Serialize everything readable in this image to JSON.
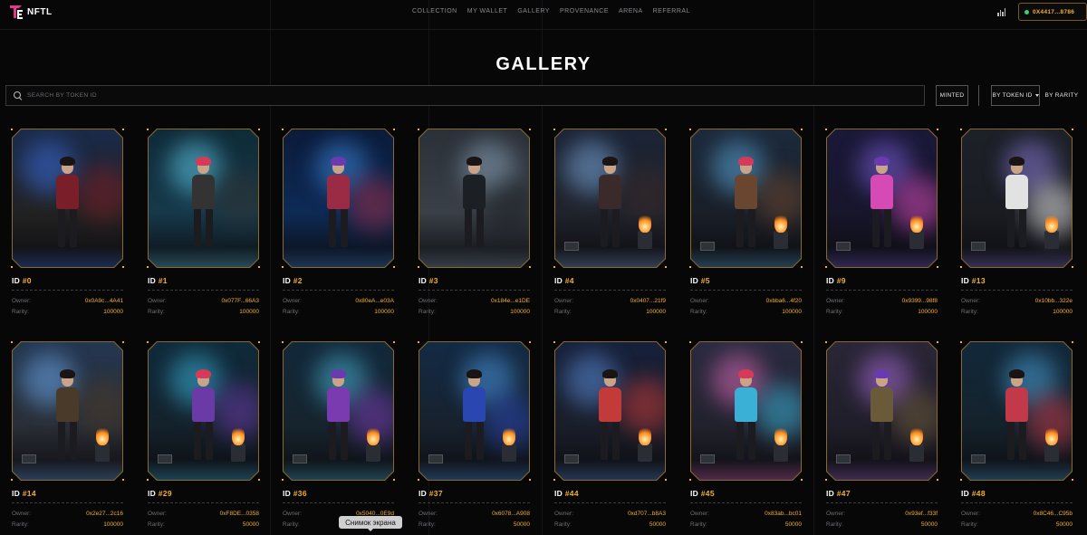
{
  "app": {
    "logo_text": "NFTL"
  },
  "nav": {
    "items": [
      "COLLECTION",
      "MY WALLET",
      "GALLERY",
      "PROVENANCE",
      "ARENA",
      "REFERRAL"
    ]
  },
  "wallet": {
    "address": "0X4417...8786",
    "status_color": "#3bd16f"
  },
  "page": {
    "title": "GALLERY"
  },
  "search": {
    "placeholder": "SEARCH BY TOKEN ID",
    "value": ""
  },
  "filters": {
    "minted_label": "MINTED",
    "sort_label": "BY TOKEN ID",
    "rarity_label": "BY RARITY"
  },
  "labels": {
    "id_prefix": "ID",
    "owner": "Owner:",
    "rarity": "Rarity:"
  },
  "cards": [
    {
      "id": "#0",
      "owner": "0x0A9c...4A41",
      "rarity": "100000",
      "palette": [
        "#1a2a4a",
        "#3a6bd6",
        "#7a1f2a",
        "#222"
      ]
    },
    {
      "id": "#1",
      "owner": "0x077F...66A3",
      "rarity": "100000",
      "palette": [
        "#0f2a38",
        "#5ec8e6",
        "#333",
        "#16394a"
      ]
    },
    {
      "id": "#2",
      "owner": "0x80eA...e03A",
      "rarity": "100000",
      "palette": [
        "#0b1b3a",
        "#3d86d9",
        "#9b2a44",
        "#0d2a55"
      ]
    },
    {
      "id": "#3",
      "owner": "0x184e...e1DE",
      "rarity": "100000",
      "palette": [
        "#2a3038",
        "#8aa2b8",
        "#1c1f24",
        "#3a4048"
      ]
    },
    {
      "id": "#4",
      "owner": "0x0407...21f9",
      "rarity": "100000",
      "palette": [
        "#1b2436",
        "#7aa6d9",
        "#3a2a2a",
        "#20232c"
      ]
    },
    {
      "id": "#5",
      "owner": "0xbba6...4f20",
      "rarity": "100000",
      "palette": [
        "#1c2a3c",
        "#5aa6d8",
        "#6a4630",
        "#1a1f28"
      ]
    },
    {
      "id": "#9",
      "owner": "0x9399...98f8",
      "rarity": "100000",
      "palette": [
        "#1a1838",
        "#7a5fd6",
        "#d64ab5",
        "#17162c"
      ]
    },
    {
      "id": "#13",
      "owner": "0x10bb...322e",
      "rarity": "100000",
      "palette": [
        "#1c2028",
        "#8a7ad6",
        "#e2e2e2",
        "#1a1c22"
      ]
    },
    {
      "id": "#14",
      "owner": "0x2e27...2c16",
      "rarity": "100000",
      "palette": [
        "#233650",
        "#6aa6e6",
        "#4a3a2a",
        "#2a2e36"
      ]
    },
    {
      "id": "#29",
      "owner": "0xF8DE...0358",
      "rarity": "50000",
      "palette": [
        "#0f2a3a",
        "#3ab0d6",
        "#6a3aa6",
        "#14222c"
      ]
    },
    {
      "id": "#36",
      "owner": "0x5040...0E9d",
      "rarity": "50000",
      "palette": [
        "#12283a",
        "#4ab0d0",
        "#7a3ab0",
        "#16242e"
      ]
    },
    {
      "id": "#37",
      "owner": "0x6078...A908",
      "rarity": "50000",
      "palette": [
        "#132a44",
        "#4a96e0",
        "#2a46b0",
        "#17222e"
      ]
    },
    {
      "id": "#44",
      "owner": "0xd707...b8A3",
      "rarity": "50000",
      "palette": [
        "#16203a",
        "#5a8ad6",
        "#c23a3a",
        "#1a1e2a"
      ]
    },
    {
      "id": "#45",
      "owner": "0x83ab...bc01",
      "rarity": "50000",
      "palette": [
        "#2a2a40",
        "#d86ab6",
        "#3ab0d6",
        "#22222e"
      ]
    },
    {
      "id": "#47",
      "owner": "0x93ef...f33f",
      "rarity": "50000",
      "palette": [
        "#2a2636",
        "#a86ad6",
        "#6a5a3a",
        "#201e2a"
      ]
    },
    {
      "id": "#48",
      "owner": "0x8C46...C95b",
      "rarity": "50000",
      "palette": [
        "#12283a",
        "#4aa0d6",
        "#c23a4a",
        "#14222c"
      ]
    }
  ],
  "tooltip": {
    "text": "Снимок экрана"
  }
}
